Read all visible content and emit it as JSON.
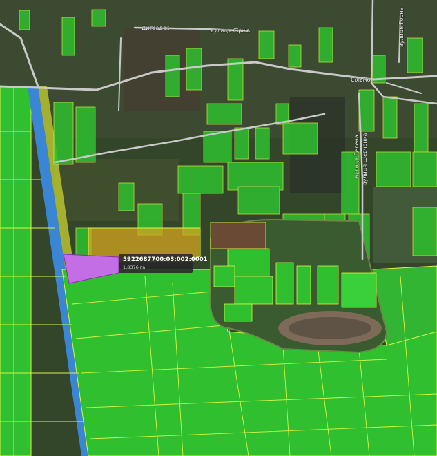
{
  "map": {
    "street_labels": [
      {
        "id": "dytsadok",
        "text": "Дитсадок"
      },
      {
        "id": "sirykiv",
        "text": "вулиця Сірків"
      },
      {
        "id": "selmo",
        "text": "Сільмо"
      },
      {
        "id": "shevchenka",
        "text": "вулиця Шевченка"
      },
      {
        "id": "zelena",
        "text": "вулиця Зелена"
      },
      {
        "id": "top-right",
        "text": "вулиця Горна"
      }
    ],
    "colors": {
      "parcel_fill": "#2fbf2f",
      "parcel_outline": "#d7f542",
      "selected_parcel": "#c46ee6",
      "highlighted_parcel": "#d4a51f",
      "canal": "#3a86d4",
      "road": "#c9c9c9"
    }
  },
  "popup": {
    "cadastral_number": "5922687700:03:002:0001",
    "area": "1,8376 га"
  }
}
